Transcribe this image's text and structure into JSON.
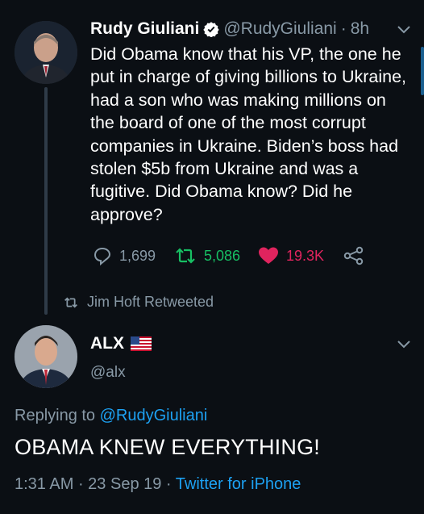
{
  "tweet": {
    "author_name": "Rudy Giuliani",
    "handle": "@RudyGiuliani",
    "separator": "·",
    "age": "8h",
    "body": "Did Obama know that his VP, the one he put in charge of giving billions to Ukraine, had a son who was making millions on the board of one of the most corrupt companies in Ukraine. Biden’s boss had stolen $5b from Ukraine and was a fugitive. Did Obama know? Did he approve?",
    "replies": "1,699",
    "retweets": "5,086",
    "likes": "19.3K",
    "icons": {
      "reply": "reply-icon",
      "retweet": "retweet-icon",
      "like": "heart-icon",
      "share": "share-icon"
    }
  },
  "retweet_notice": {
    "label": "Jim Hoft Retweeted"
  },
  "reply": {
    "author_name": "ALX",
    "handle": "@alx",
    "replying_prefix": "Replying to ",
    "replying_to": "@RudyGiuliani",
    "body": "OBAMA KNEW EVERYTHING!",
    "time": "1:31 AM",
    "date": "23 Sep 19",
    "sep": " · ",
    "source": "Twitter for iPhone"
  },
  "colors": {
    "background": "#0b0f14",
    "link": "#1da1f2",
    "retweet": "#17bf63",
    "like": "#e0245e",
    "muted": "#8899a6"
  }
}
